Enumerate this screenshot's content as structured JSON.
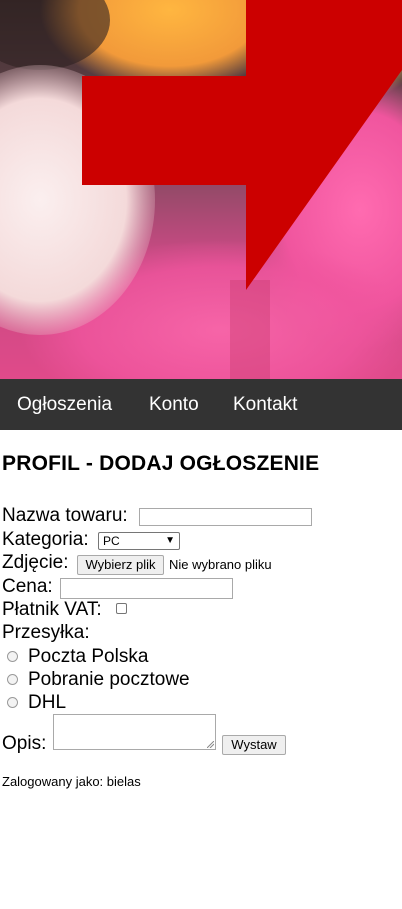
{
  "nav": {
    "items": [
      {
        "label": "Ogłoszenia"
      },
      {
        "label": "Konto"
      },
      {
        "label": "Kontakt"
      }
    ]
  },
  "page": {
    "title": "PROFIL - DODAJ OGŁOSZENIE"
  },
  "form": {
    "name_label": "Nazwa towaru:",
    "name_value": "",
    "category_label": "Kategoria:",
    "category_selected": "PC",
    "photo_label": "Zdjęcie:",
    "photo_button": "Wybierz plik",
    "photo_status": "Nie wybrano pliku",
    "price_label": "Cena:",
    "price_value": "",
    "vat_label": "Płatnik VAT:",
    "vat_checked": false,
    "shipping_label": "Przesyłka:",
    "shipping_options": [
      {
        "label": "Poczta Polska"
      },
      {
        "label": "Pobranie pocztowe"
      },
      {
        "label": "DHL"
      }
    ],
    "description_label": "Opis:",
    "submit_label": "Wystaw"
  },
  "footer": {
    "logged_in_text": "Zalogowany jako: bielas"
  },
  "colors": {
    "nav_bg": "#333333",
    "arrow_red": "#cc0000"
  },
  "icons": {
    "banner_arrow": "right-arrow-icon",
    "select_arrow": "caret-down-icon"
  }
}
